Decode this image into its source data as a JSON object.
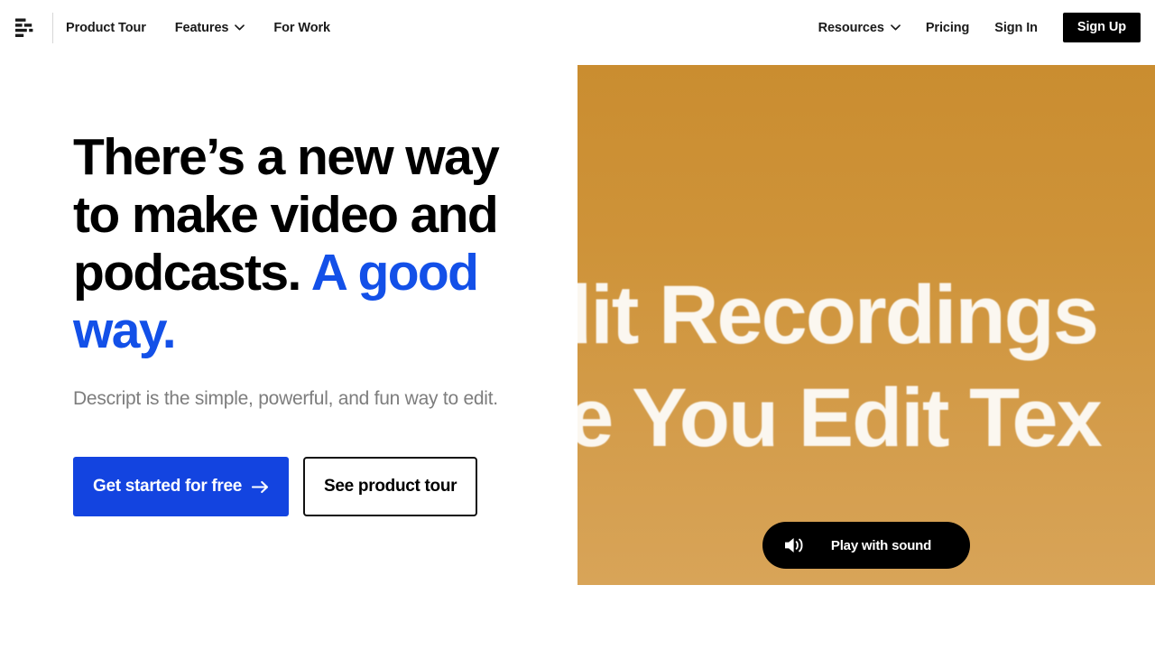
{
  "brand": {
    "logo_icon": "descript-logo-icon",
    "accent_blue": "#1350E8",
    "button_blue": "#1344E0",
    "black": "#000000",
    "video_gradient_top": "#CA8D30",
    "video_gradient_bottom": "#D8A458"
  },
  "header": {
    "primary_nav": [
      {
        "label": "Product Tour",
        "has_dropdown": false
      },
      {
        "label": "Features",
        "has_dropdown": true,
        "icon": "chevron-down-icon"
      },
      {
        "label": "For Work",
        "has_dropdown": false
      }
    ],
    "secondary_nav": [
      {
        "label": "Resources",
        "has_dropdown": true,
        "icon": "chevron-down-icon"
      },
      {
        "label": "Pricing",
        "has_dropdown": false
      },
      {
        "label": "Sign In",
        "has_dropdown": false
      }
    ],
    "signup_label": "Sign Up"
  },
  "hero": {
    "headline_part1": "There’s a new way to make video and podcasts. ",
    "headline_accent": "A good way.",
    "subhead": "Descript is the simple, powerful, and fun way to edit.",
    "primary_cta": "Get started for free",
    "primary_cta_icon": "arrow-right-icon",
    "secondary_cta": "See product tour"
  },
  "video": {
    "caption_line_1": "dit Recordings",
    "caption_line_2": "ke You Edit Tex",
    "play_button_label": "Play with sound",
    "play_button_icon": "speaker-wave-icon"
  }
}
